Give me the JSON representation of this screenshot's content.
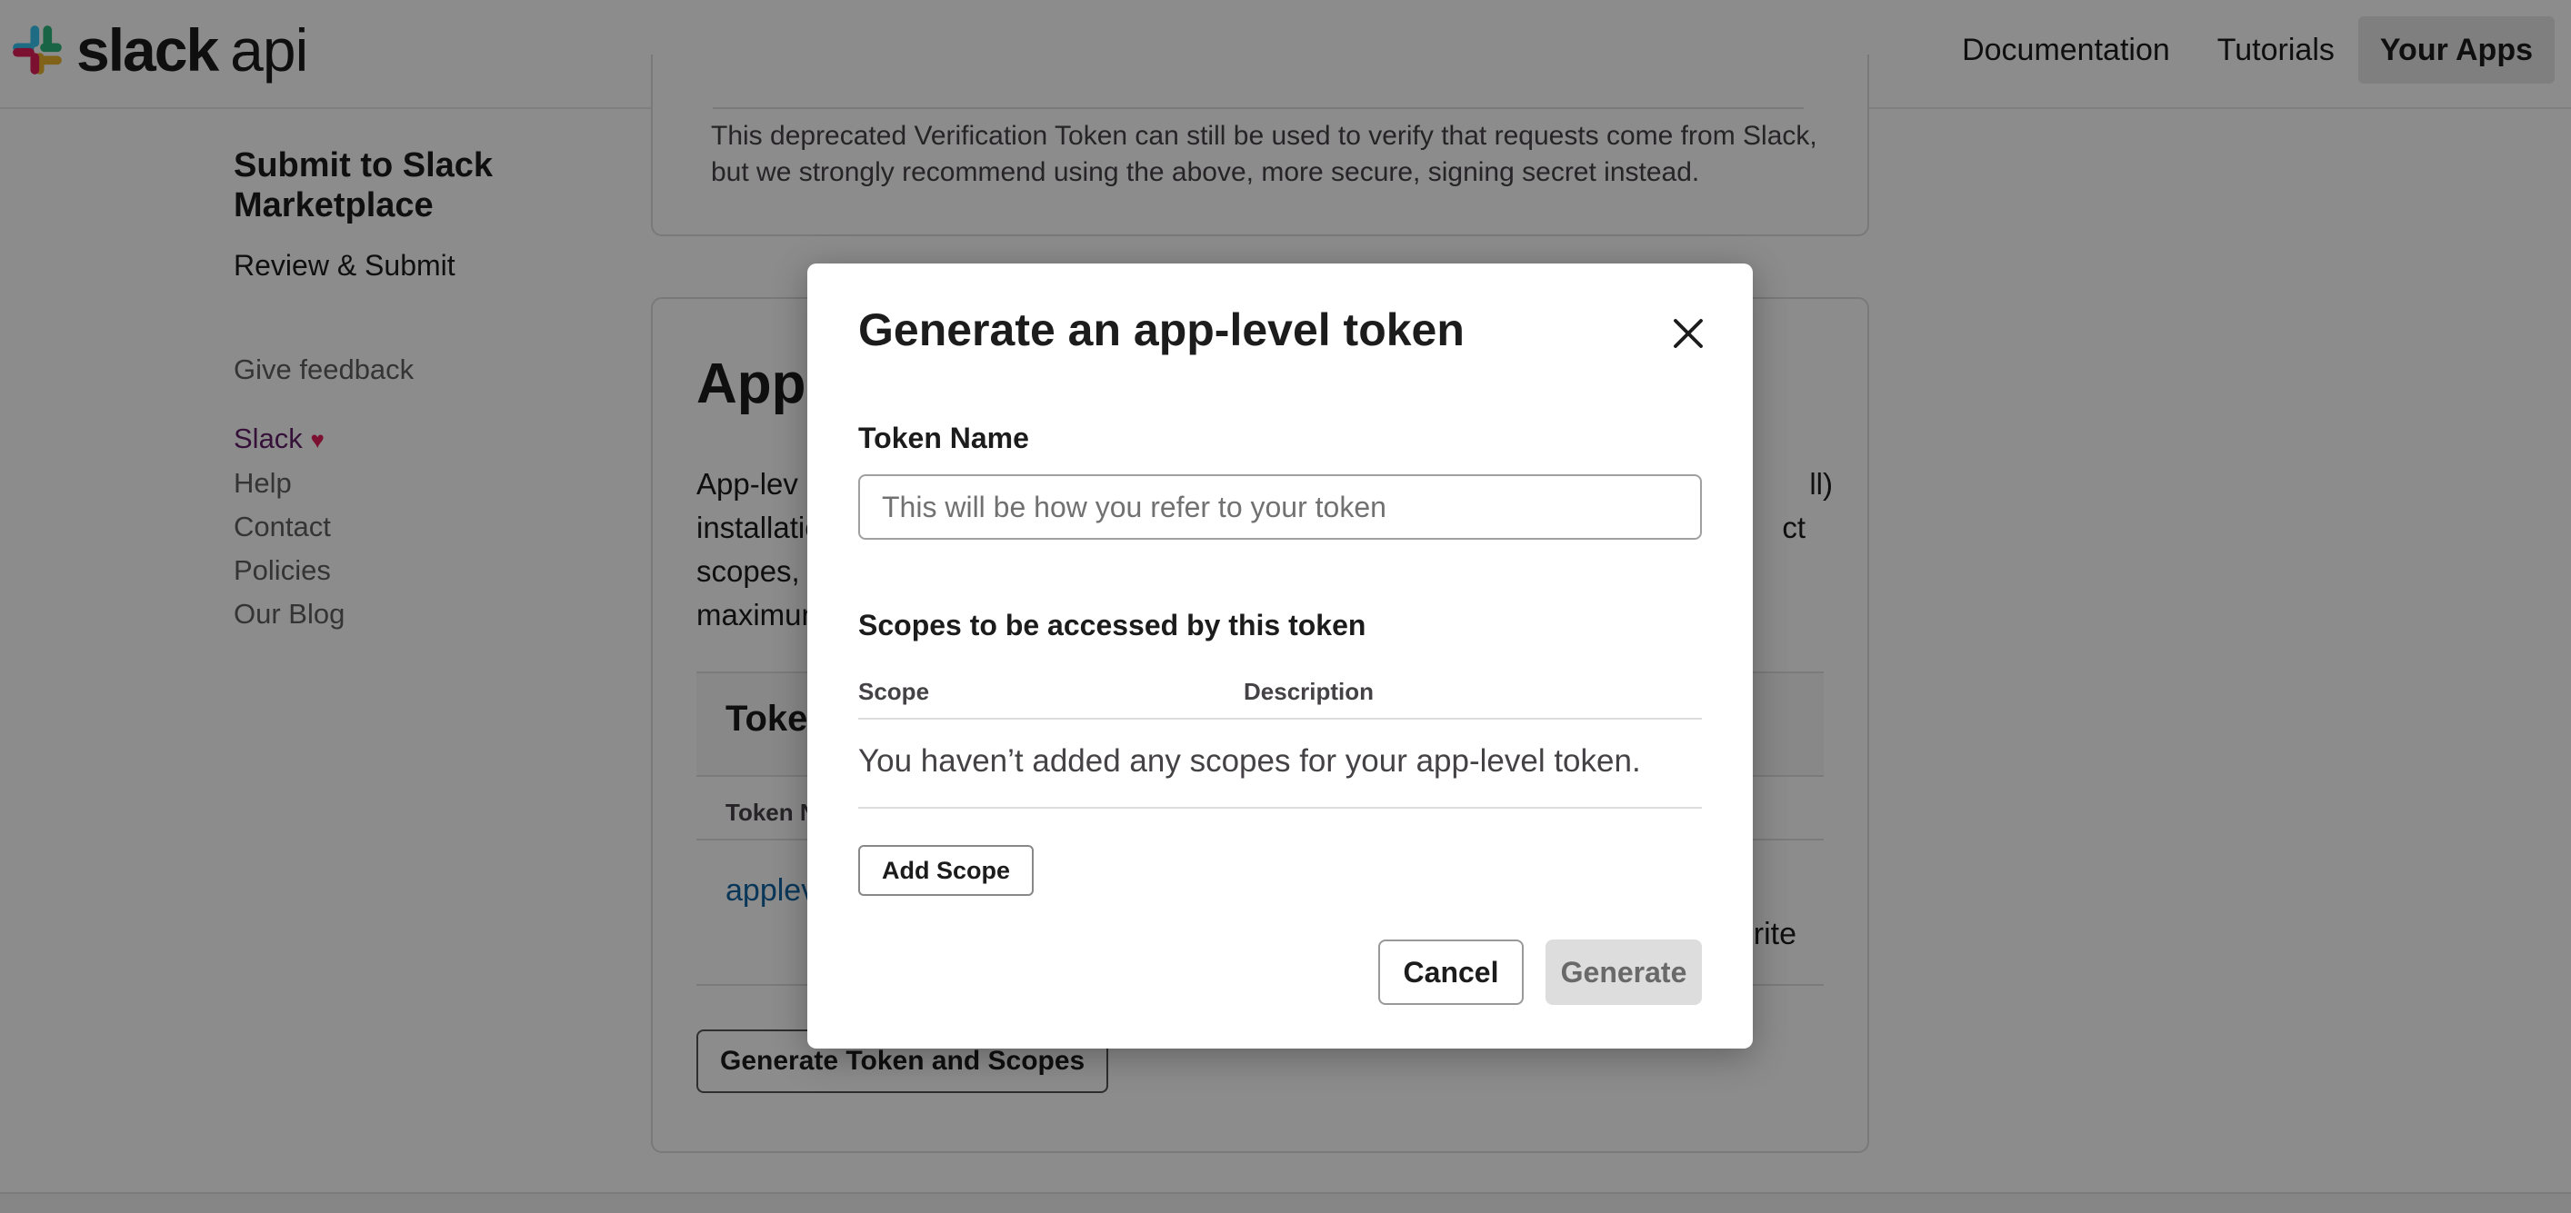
{
  "header": {
    "logo_text": "slack",
    "logo_api": "api",
    "nav": [
      {
        "label": "Documentation"
      },
      {
        "label": "Tutorials"
      },
      {
        "label": "Your Apps"
      }
    ]
  },
  "sidebar": {
    "submit_title": "Submit to Slack Marketplace",
    "review_submit": "Review & Submit",
    "give_feedback": "Give feedback",
    "footer_links": [
      "Slack",
      "Help",
      "Contact",
      "Policies",
      "Our Blog"
    ],
    "heart": "♥"
  },
  "verification_card": {
    "text": "This deprecated Verification Token can still be used to verify that requests come from Slack, but we strongly recommend using the above, more secure, signing secret instead."
  },
  "app_tokens_card": {
    "title_fragment": "App-",
    "body_fragments": [
      "App-lev",
      "ll)",
      "installatio",
      "ct",
      "scopes, s",
      "maximum"
    ],
    "table_title_fragment": "Toke",
    "column_fragment": "Token N",
    "row_link_fragment": "applev",
    "row_right_fragment": "rite",
    "generate_button": "Generate Token and Scopes"
  },
  "modal": {
    "title": "Generate an app-level token",
    "token_name_label": "Token Name",
    "token_name_placeholder": "This will be how you refer to your token",
    "token_name_value": "",
    "scopes_label": "Scopes to be accessed by this token",
    "scope_col": "Scope",
    "description_col": "Description",
    "empty_message": "You haven’t added any scopes for your app-level token.",
    "add_scope": "Add Scope",
    "cancel": "Cancel",
    "generate": "Generate"
  },
  "colors": {
    "logo_red": "#e01e5a",
    "logo_blue": "#36c5f0",
    "logo_green": "#2eb67d",
    "logo_yellow": "#ecb22e",
    "link": "#1264a3",
    "slack_aubergine": "#611f69"
  }
}
